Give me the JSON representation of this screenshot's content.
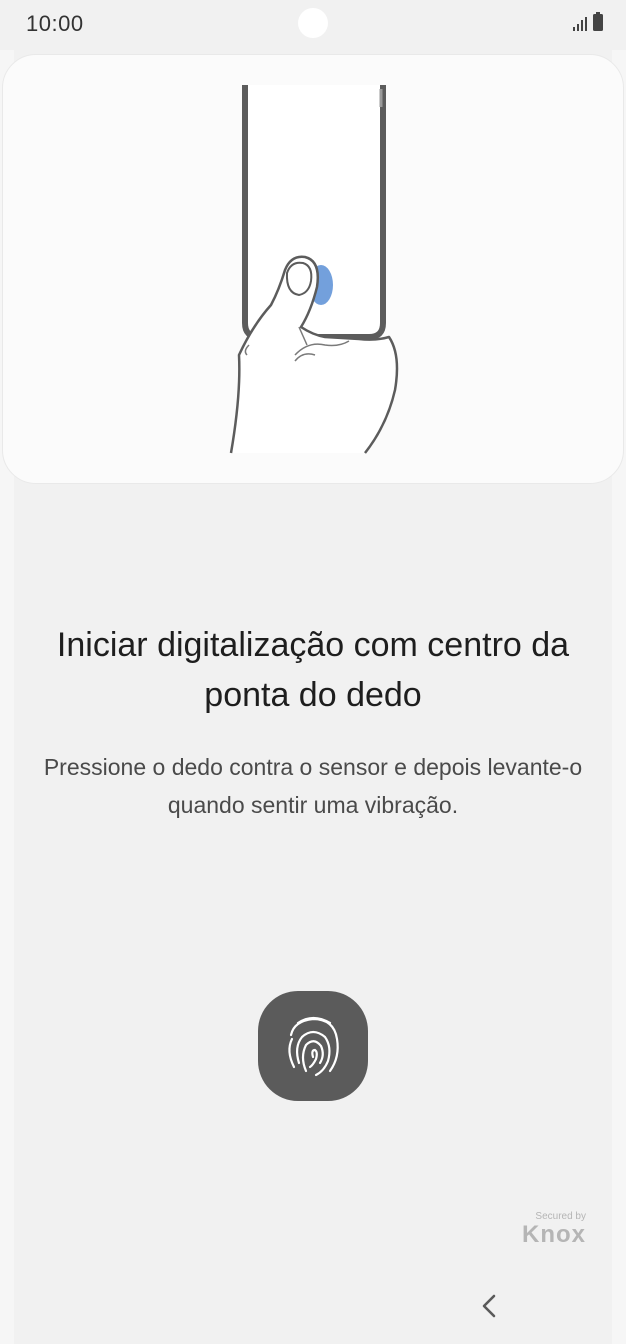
{
  "status_bar": {
    "time": "10:00",
    "icons": [
      "signal-icon",
      "battery-icon"
    ]
  },
  "illustration": {
    "icon": "finger-on-sensor-illustration",
    "accent_color": "#5b8fd6"
  },
  "main": {
    "title": "Iniciar digitalização com centro da ponta do dedo",
    "subtitle": "Pressione o dedo contra o sensor e depois levante-o quando sentir uma vibração."
  },
  "fingerprint_button": {
    "icon": "fingerprint-icon",
    "color": "#5b5b5b"
  },
  "knox": {
    "secured_label": "Secured by",
    "brand": "Knox"
  },
  "navigation": {
    "back_icon": "chevron-left-icon"
  }
}
